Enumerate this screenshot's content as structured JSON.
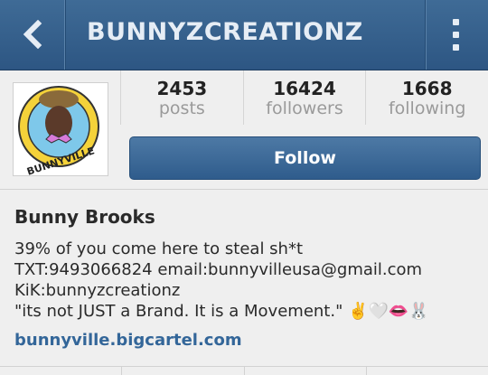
{
  "header": {
    "title": "BUNNYZCREATIONZ"
  },
  "avatar": {
    "logo_text": "BUNNYVILLE"
  },
  "stats": [
    {
      "value": "2453",
      "label": "posts"
    },
    {
      "value": "16424",
      "label": "followers"
    },
    {
      "value": "1668",
      "label": "following"
    }
  ],
  "follow_label": "Follow",
  "bio": {
    "name": "Bunny Brooks",
    "lines": [
      "39% of you come here to steal sh*t",
      "TXT:9493066824 email:bunnyvilleusa@gmail.com",
      "KiK:bunnyzcreationz",
      "\"its not JUST a Brand. It is a Movement.\" ✌️🤍👄🐰"
    ],
    "link": "bunnyville.bigcartel.com"
  },
  "colors": {
    "header": "#2d5683",
    "follow_button": "#3a6796",
    "link": "#336699"
  }
}
